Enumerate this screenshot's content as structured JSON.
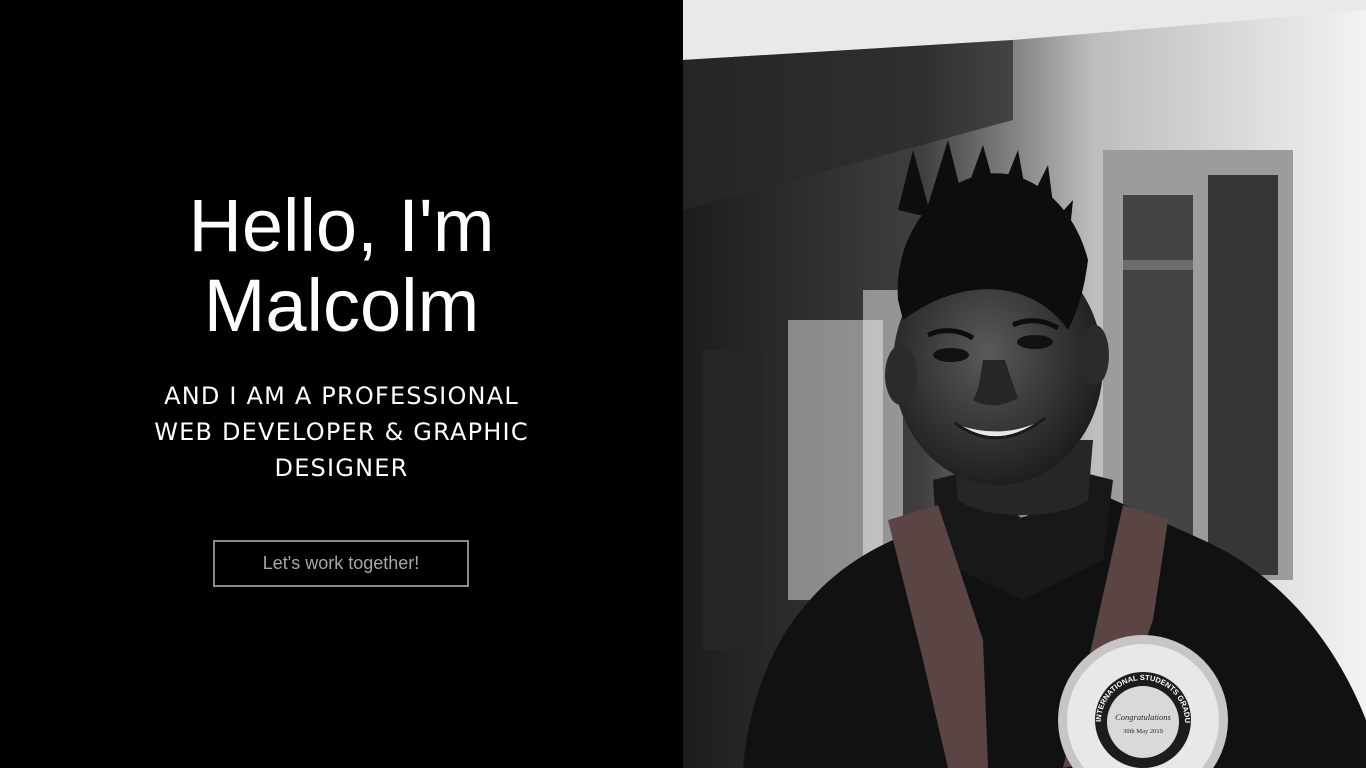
{
  "hero": {
    "title_line1": "Hello, I'm",
    "title_line2": "Malcolm",
    "subtitle_line1": "AND I AM A PROFESSIONAL",
    "subtitle_line2": "WEB DEVELOPER & GRAPHIC",
    "subtitle_line3": "DESIGNER",
    "cta_label": "Let's work together!"
  },
  "portrait": {
    "alt": "Malcolm in graduation gown",
    "rosette_arc_text": "INTERNATIONAL STUDENTS GRADUATION",
    "rosette_center_line1": "Congratulations",
    "rosette_center_line2": "30th May 2019"
  },
  "colors": {
    "background": "#000000",
    "text": "#ffffff",
    "button_border": "#8a8a8a",
    "button_text": "#a8a8a8",
    "stole": "#5a4444"
  }
}
